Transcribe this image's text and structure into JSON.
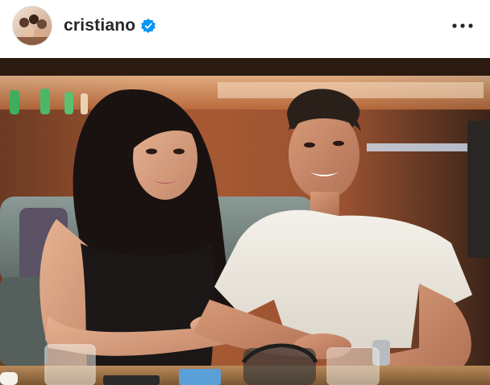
{
  "post": {
    "author": {
      "username": "cristiano",
      "verified": true,
      "avatar_icon": "profile-photo-avatar"
    },
    "header": {
      "more_icon": "more-options-icon",
      "verified_icon": "verified-badge-icon"
    },
    "photo": {
      "subject": "photo"
    },
    "colors": {
      "username": "#262626",
      "verified_badge": "#0095f6",
      "background": "#ffffff"
    }
  }
}
